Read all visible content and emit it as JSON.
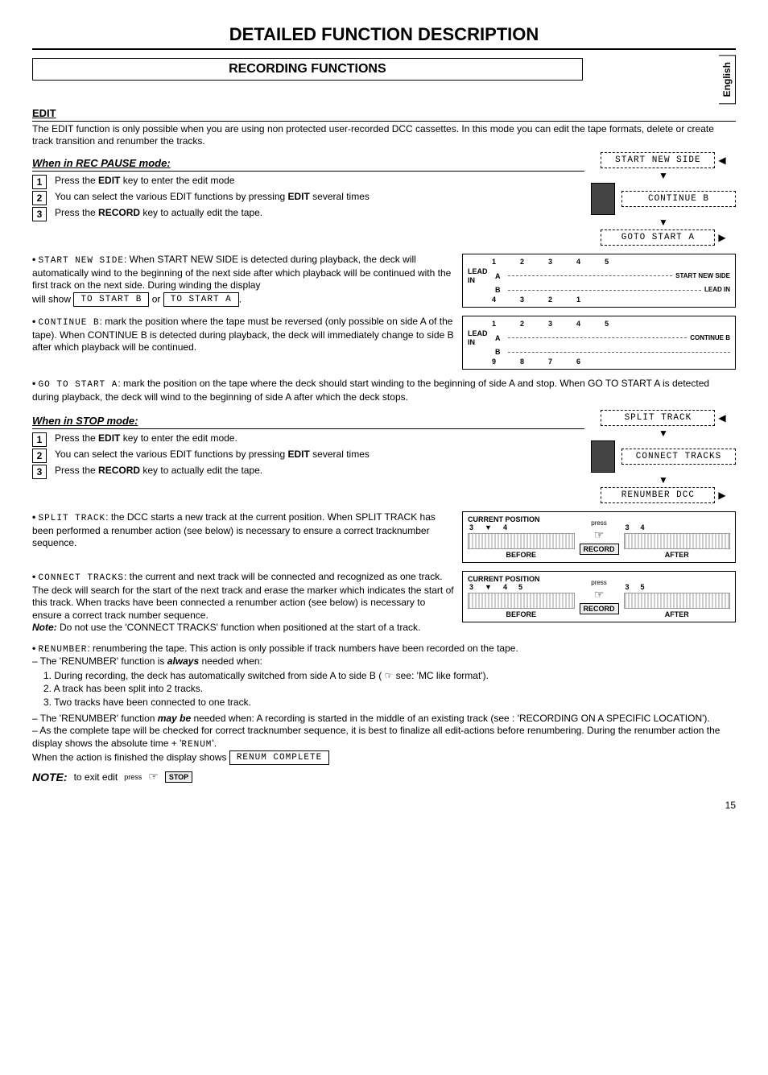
{
  "page": {
    "title": "DETAILED FUNCTION DESCRIPTION",
    "section_title": "RECORDING FUNCTIONS",
    "language_tab": "English",
    "page_number": "15"
  },
  "edit": {
    "heading": "EDIT",
    "intro": "The EDIT function is only possible when you are using non protected user-recorded DCC cassettes. In this mode you can edit the tape formats, delete or create track transition and renumber the tracks."
  },
  "rec_pause": {
    "heading": "When in REC PAUSE mode:",
    "steps": [
      {
        "n": "1",
        "text_a": "Press the ",
        "key": "EDIT",
        "text_b": " key to enter the edit mode"
      },
      {
        "n": "2",
        "text_a": "You can select the various EDIT functions by pressing ",
        "key": "EDIT",
        "text_b": " several times"
      },
      {
        "n": "3",
        "text_a": "Press the ",
        "key": "RECORD",
        "text_b": " key to actually edit the tape."
      }
    ],
    "flow": {
      "a": "START NEW SIDE",
      "b": "CONTINUE B",
      "c": "GOTO START A"
    },
    "start_new_side": {
      "label": "START NEW SIDE",
      "body": ": When START NEW SIDE is detected during playback, the deck will automatically wind to the beginning of the next side after which playback will be continued with the first track on the next side. During winding the display",
      "will_show": "will show",
      "box1": "TO START B",
      "or": "or",
      "box2": "TO START A",
      "period": "."
    },
    "continue_b": {
      "label": "CONTINUE B",
      "body": ": mark the position where the tape must be reversed (only possible on side A of the tape). When CONTINUE B is detected during playback, the deck will immediately change to side B after which playback will be continued."
    },
    "goto_start_a": {
      "label": "GO TO START A",
      "body": ": mark the position on the tape where the deck should start winding to the beginning of side A and stop. When GO TO START A is detected during playback, the deck will wind to the beginning of side A after which the deck stops."
    },
    "diagram1": {
      "top_nums": [
        "1",
        "2",
        "3",
        "4",
        "5"
      ],
      "lead_in": "LEAD IN",
      "side_a": "A",
      "side_b": "B",
      "right1": "START NEW SIDE",
      "right2": "LEAD IN",
      "bottom_nums": [
        "4",
        "3",
        "2",
        "1"
      ]
    },
    "diagram2": {
      "top_nums": [
        "1",
        "2",
        "3",
        "4",
        "5"
      ],
      "lead_in": "LEAD IN",
      "side_a": "A",
      "side_b": "B",
      "right": "CONTINUE B",
      "bottom_nums": [
        "9",
        "8",
        "7",
        "6"
      ]
    }
  },
  "stop_mode": {
    "heading": "When in STOP mode:",
    "steps": [
      {
        "n": "1",
        "text_a": "Press the ",
        "key": "EDIT",
        "text_b": " key to enter the edit mode."
      },
      {
        "n": "2",
        "text_a": "You can select the various EDIT functions by pressing ",
        "key": "EDIT",
        "text_b": " several times"
      },
      {
        "n": "3",
        "text_a": "Press the ",
        "key": "RECORD",
        "text_b": " key to actually edit the tape."
      }
    ],
    "flow": {
      "a": "SPLIT TRACK",
      "b": "CONNECT TRACKS",
      "c": "RENUMBER DCC"
    },
    "split_track": {
      "label": "SPLIT TRACK",
      "body": ": the DCC starts a new track at the current position. When SPLIT TRACK has been performed a renumber action (see below) is necessary to ensure a correct tracknumber sequence."
    },
    "connect_tracks": {
      "label": "CONNECT TRACKS",
      "body": ": the current and next track will be connected and recognized as one track. The deck will search for the start of the next track and erase the marker which indicates the start of this track. When tracks have been connected a renumber action (see below) is necessary to ensure a correct track number sequence.",
      "note_label": "Note:",
      "note_body": " Do not use the 'CONNECT TRACKS' function when positioned at the start of a track."
    },
    "ba_split": {
      "title": "CURRENT POSITION",
      "before_nums": [
        "3",
        "4"
      ],
      "after_nums": [
        "3",
        "4"
      ],
      "mid_press": "press",
      "mid_key": "RECORD",
      "before": "BEFORE",
      "after": "AFTER"
    },
    "ba_connect": {
      "title": "CURRENT POSITION",
      "before_nums": [
        "3",
        "4",
        "5"
      ],
      "after_nums": [
        "3",
        "5"
      ],
      "mid_press": "press",
      "mid_key": "RECORD",
      "before": "BEFORE",
      "after": "AFTER"
    },
    "renumber": {
      "label": "RENUMBER",
      "intro": ": renumbering the tape. This action is only possible if track numbers have been recorded on the tape.",
      "always_line_a": "– The 'RENUMBER' function is ",
      "always_word": "always",
      "always_line_b": " needed when:",
      "items": [
        "1. During recording, the deck has automatically switched from side A to side B ( ☞ see: 'MC like format').",
        "2. A track has been split into 2 tracks.",
        "3. Two tracks have been connected to one track."
      ],
      "maybe_line_a": "– The 'RENUMBER' function ",
      "maybe_word": "may be",
      "maybe_line_b": " needed when: A recording is started in the middle of an existing track (see : 'RECORDING ON A SPECIFIC LOCATION').",
      "finalize": "– As the complete tape will be checked for correct tracknumber sequence, it is best to finalize all edit-actions before renumbering. During the renumber action the display shows the absolute time + '",
      "finalize_lcd": "RENUM",
      "finalize_end": "'.",
      "done_a": "When the action is finished the display shows ",
      "done_box": "RENUM COMPLETE"
    }
  },
  "exit_note": {
    "label": "NOTE:",
    "text": " to exit edit",
    "press": "press",
    "key": "STOP"
  }
}
